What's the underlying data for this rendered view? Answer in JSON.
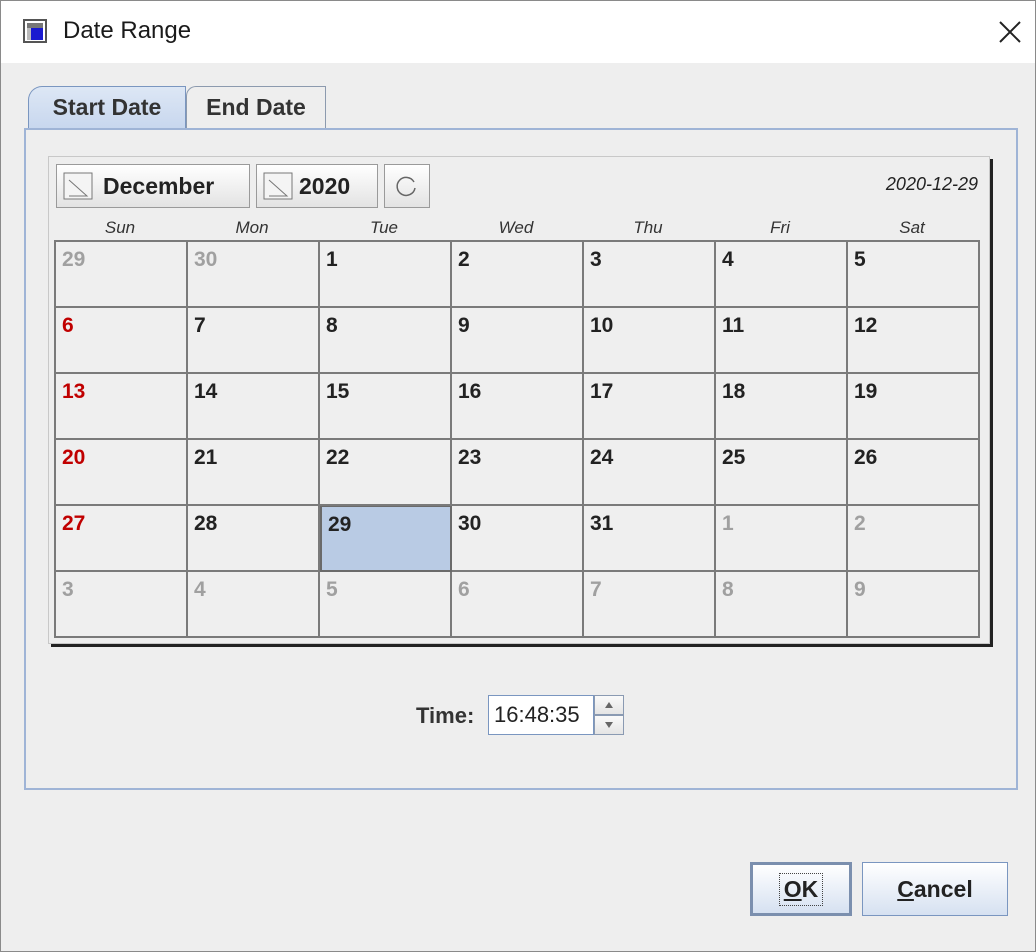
{
  "window": {
    "title": "Date Range"
  },
  "tabs": [
    {
      "label": "Start Date",
      "active": true
    },
    {
      "label": "End Date",
      "active": false
    }
  ],
  "calendar": {
    "month_label": "December",
    "year_label": "2020",
    "selected_date_text": "2020-12-29",
    "weekdays": [
      "Sun",
      "Mon",
      "Tue",
      "Wed",
      "Thu",
      "Fri",
      "Sat"
    ],
    "weeks": [
      [
        "29",
        "30",
        "1",
        "2",
        "3",
        "4",
        "5"
      ],
      [
        "6",
        "7",
        "8",
        "9",
        "10",
        "11",
        "12"
      ],
      [
        "13",
        "14",
        "15",
        "16",
        "17",
        "18",
        "19"
      ],
      [
        "20",
        "21",
        "22",
        "23",
        "24",
        "25",
        "26"
      ],
      [
        "27",
        "28",
        "29",
        "30",
        "31",
        "1",
        "2"
      ],
      [
        "3",
        "4",
        "5",
        "6",
        "7",
        "8",
        "9"
      ]
    ],
    "colors": {
      "sunday": "#c00000",
      "other_month": "#a0a0a0",
      "selected_bg": "#b9cbe4"
    }
  },
  "time": {
    "label": "Time:",
    "value": "16:48:35"
  },
  "buttons": {
    "ok": {
      "mnemonic": "O",
      "rest": "K"
    },
    "cancel": {
      "mnemonic": "C",
      "rest": "ancel"
    }
  }
}
